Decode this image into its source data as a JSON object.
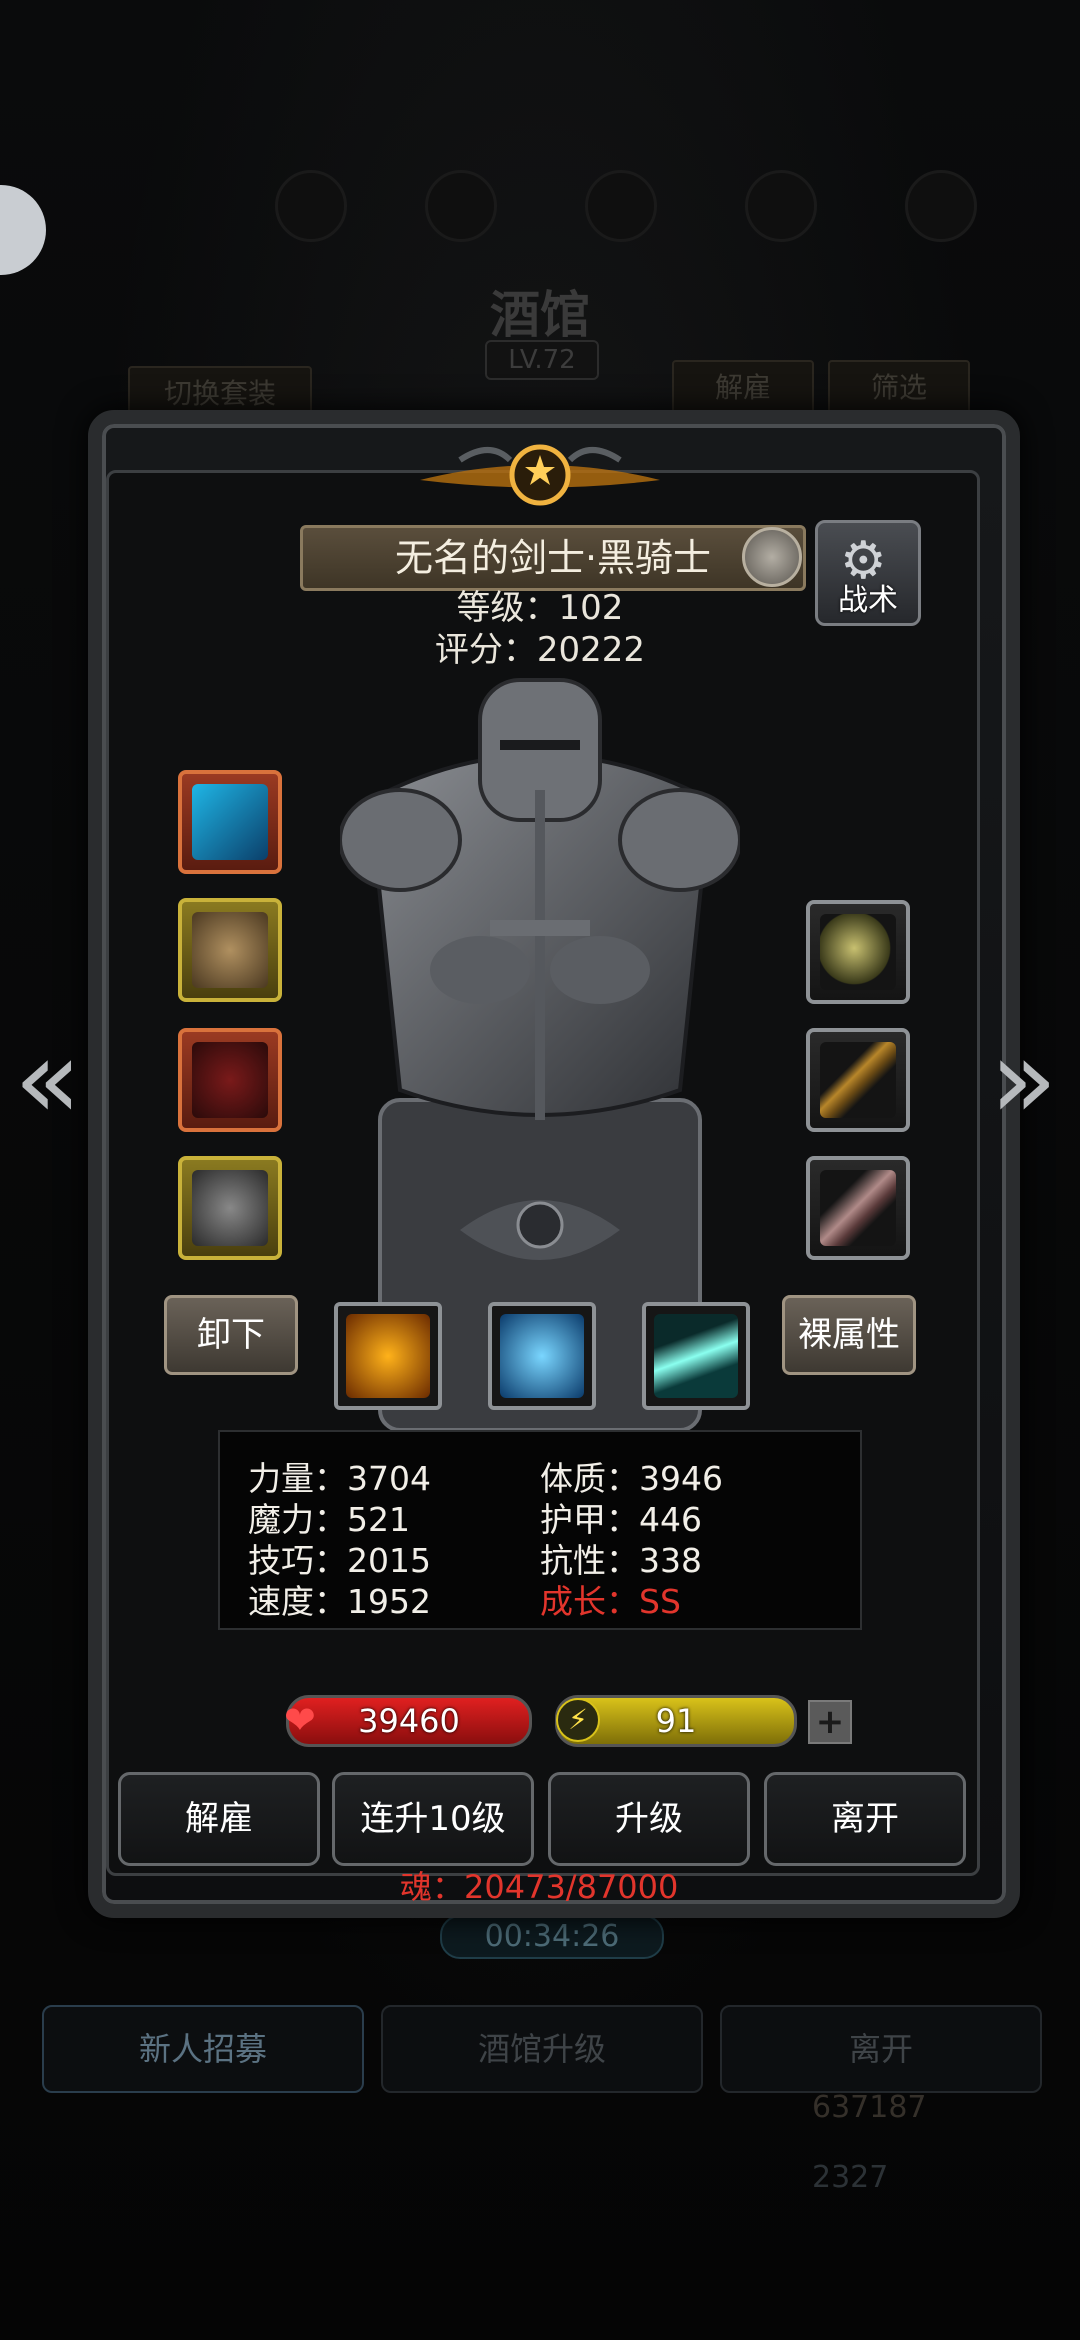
{
  "background": {
    "title": "酒馆",
    "level": "LV.72",
    "switch_outfit": "切换套装",
    "dismiss": "解雇",
    "filter": "筛选",
    "timer": "00:34:26",
    "tabs": [
      "新人招募",
      "酒馆升级",
      "离开"
    ],
    "currency_1": "637187",
    "currency_2": "2327"
  },
  "hero": {
    "name": "无名的剑士·黑骑士",
    "level_label": "等级：102",
    "score_label": "评分：20222",
    "tactic_label": "战术"
  },
  "equipment": {
    "left": [
      "sword-icon",
      "chest-armor-icon",
      "helmet-icon",
      "ring-icon"
    ],
    "right": [
      "gem-icon",
      "scepter-icon",
      "feather-icon"
    ]
  },
  "controls": {
    "unequip": "卸下",
    "base_attr": "裸属性",
    "skills": [
      "shield-skill-icon",
      "eye-skill-icon",
      "slash-skill-icon"
    ]
  },
  "stats": {
    "str": "力量：3704",
    "con": "体质：3946",
    "mag": "魔力：521",
    "arm": "护甲：446",
    "skl": "技巧：2015",
    "res": "抗性：338",
    "spd": "速度：1952",
    "growth": "成长：SS"
  },
  "bars": {
    "hp": "39460",
    "energy": "91",
    "plus": "+"
  },
  "actions": [
    "解雇",
    "连升10级",
    "升级",
    "离开"
  ],
  "soul": "魂：20473/87000",
  "colors": {
    "accent_red": "#e2352c",
    "hp_red": "#e02020",
    "energy_yellow": "#d9c21a",
    "gold_frame": "#c9b23a"
  }
}
